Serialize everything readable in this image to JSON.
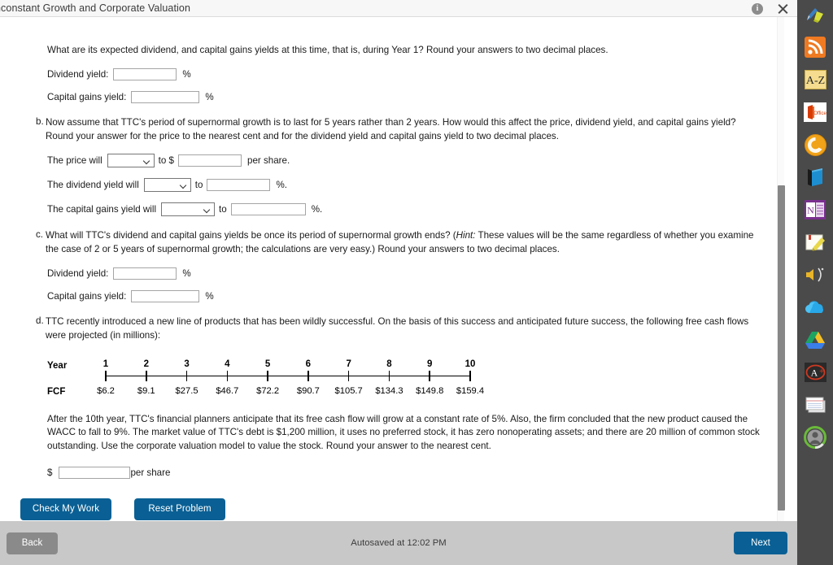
{
  "header": {
    "title": "nconstant Growth and Corporate Valuation",
    "info_icon": "info-icon",
    "close_icon": "close-icon"
  },
  "intro": {
    "text": "What are its expected dividend, and capital gains yields at this time, that is, during Year 1? Round your answers to two decimal places."
  },
  "fields_a": {
    "dividend_label": "Dividend yield:",
    "dividend_value": "",
    "dividend_suffix": "%",
    "capgains_label": "Capital gains yield:",
    "capgains_value": "",
    "capgains_suffix": "%"
  },
  "question_b": {
    "letter": "b.",
    "text": "Now assume that TTC's period of supernormal growth is to last for 5 years rather than 2 years. How would this affect the price, dividend yield, and capital gains yield? Round your answer for the price to the nearest cent and for the dividend yield and capital gains yield to two decimal places.",
    "price_prefix": "The price will",
    "price_select_value": "",
    "price_mid": "to $",
    "price_value": "",
    "price_suffix": "per share.",
    "divyield_prefix": "The dividend yield will",
    "divyield_select_value": "",
    "divyield_mid": "to",
    "divyield_value": "",
    "divyield_suffix": "%.",
    "capgains_prefix": "The capital gains yield will",
    "capgains_select_value": "",
    "capgains_mid": "to",
    "capgains_value": "",
    "capgains_suffix": "%."
  },
  "question_c": {
    "letter": "c.",
    "text_part1": "What will TTC's dividend and capital gains yields be once its period of supernormal growth ends? (",
    "hint_word": "Hint:",
    "text_part2": " These values will be the same regardless of whether you examine the case of 2 or 5 years of supernormal growth; the calculations are very easy.) Round your answers to two decimal places.",
    "dividend_label": "Dividend yield:",
    "dividend_value": "",
    "dividend_suffix": "%",
    "capgains_label": "Capital gains yield:",
    "capgains_value": "",
    "capgains_suffix": "%"
  },
  "question_d": {
    "letter": "d.",
    "text": "TTC recently introduced a new line of products that has been wildly successful. On the basis of this success and anticipated future success, the following free cash flows were projected (in millions):",
    "after_text": "After the 10th year, TTC's financial planners anticipate that its free cash flow will grow at a constant rate of 5%. Also, the firm concluded that the new product caused the WACC to fall to 9%. The market value of TTC's debt is $1,200 million, it uses no preferred stock, it has zero nonoperating assets; and there are 20 million of common stock outstanding. Use the corporate valuation model to value the stock. Round your answer to the nearest cent.",
    "answer_dollar": "$",
    "answer_value": "",
    "answer_suffix": "per share"
  },
  "timeline": {
    "row1_label": "Year",
    "row2_label": "FCF",
    "years": [
      "1",
      "2",
      "3",
      "4",
      "5",
      "6",
      "7",
      "8",
      "9",
      "10"
    ],
    "fcf": [
      "$6.2",
      "$9.1",
      "$27.5",
      "$46.7",
      "$72.2",
      "$90.7",
      "$105.7",
      "$134.3",
      "$149.8",
      "$159.4"
    ]
  },
  "buttons": {
    "check_my_work": "Check My Work",
    "reset_problem": "Reset Problem"
  },
  "footer": {
    "back": "Back",
    "autosaved": "Autosaved at 12:02 PM",
    "next": "Next"
  },
  "sidebar": {
    "items": [
      {
        "name": "pen-highlighter-icon"
      },
      {
        "name": "rss-feed-icon"
      },
      {
        "name": "dictionary-az-icon"
      },
      {
        "name": "ms-office-icon"
      },
      {
        "name": "browser-icon"
      },
      {
        "name": "book-icon"
      },
      {
        "name": "onenote-icon"
      },
      {
        "name": "notes-highlighter-icon"
      },
      {
        "name": "audio-speaker-icon"
      },
      {
        "name": "onedrive-cloud-icon"
      },
      {
        "name": "google-drive-icon"
      },
      {
        "name": "grade-aplus-icon"
      },
      {
        "name": "index-cards-icon"
      },
      {
        "name": "user-avatar-icon"
      }
    ]
  },
  "colors": {
    "accent_blue": "#0a6094",
    "footer_gray": "#c8c8c8",
    "sidebar_dark": "#4a4a4a"
  }
}
